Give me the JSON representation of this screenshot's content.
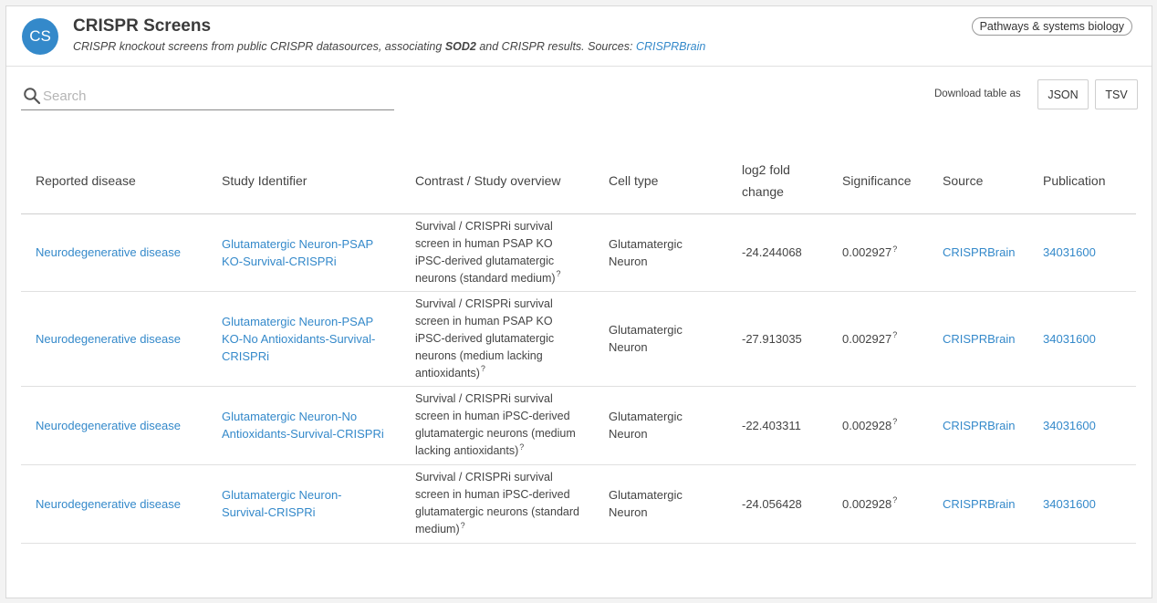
{
  "widget": {
    "avatar": "CS",
    "title": "CRISPR Screens",
    "subtitle_pre": "CRISPR knockout screens from public CRISPR datasources, associating ",
    "subtitle_gene": "SOD2",
    "subtitle_mid": " and CRISPR results. Sources: ",
    "subtitle_source": "CRISPRBrain",
    "chip": "Pathways & systems biology"
  },
  "search": {
    "placeholder": "Search",
    "value": ""
  },
  "download": {
    "label": "Download table as",
    "json": "JSON",
    "tsv": "TSV"
  },
  "table": {
    "headers": [
      "Reported disease",
      "Study Identifier",
      "Contrast / Study overview",
      "Cell type",
      "log2 fold change",
      "Significance",
      "Source",
      "Publication"
    ],
    "rows": [
      {
        "disease": "Neurodegenerative disease",
        "study": "Glutamatergic Neuron-PSAP KO-Survival-CRISPRi",
        "contrast": "Survival / CRISPRi survival screen in human PSAP KO iPSC-derived glutamatergic neurons (standard medium)",
        "cell": "Glutamatergic Neuron",
        "fold": "-24.244068",
        "significance": "0.002927",
        "source": "CRISPRBrain",
        "publication": "34031600"
      },
      {
        "disease": "Neurodegenerative disease",
        "study": "Glutamatergic Neuron-PSAP KO-No Antioxidants-Survival-CRISPRi",
        "contrast": "Survival / CRISPRi survival screen in human PSAP KO iPSC-derived glutamatergic neurons (medium lacking antioxidants)",
        "cell": "Glutamatergic Neuron",
        "fold": "-27.913035",
        "significance": "0.002927",
        "source": "CRISPRBrain",
        "publication": "34031600"
      },
      {
        "disease": "Neurodegenerative disease",
        "study": "Glutamatergic Neuron-No Antioxidants-Survival-CRISPRi",
        "contrast": "Survival / CRISPRi survival screen in human iPSC-derived glutamatergic neurons (medium lacking antioxidants)",
        "cell": "Glutamatergic Neuron",
        "fold": "-22.403311",
        "significance": "0.002928",
        "source": "CRISPRBrain",
        "publication": "34031600"
      },
      {
        "disease": "Neurodegenerative disease",
        "study": "Glutamatergic Neuron-Survival-CRISPRi",
        "contrast": "Survival / CRISPRi survival screen in human iPSC-derived glutamatergic neurons (standard medium)",
        "cell": "Glutamatergic Neuron",
        "fold": "-24.056428",
        "significance": "0.002928",
        "source": "CRISPRBrain",
        "publication": "34031600"
      }
    ],
    "help_mark": "?"
  },
  "colors": {
    "accent": "#3489ca",
    "text": "#444444",
    "border": "#d9d9d9"
  }
}
